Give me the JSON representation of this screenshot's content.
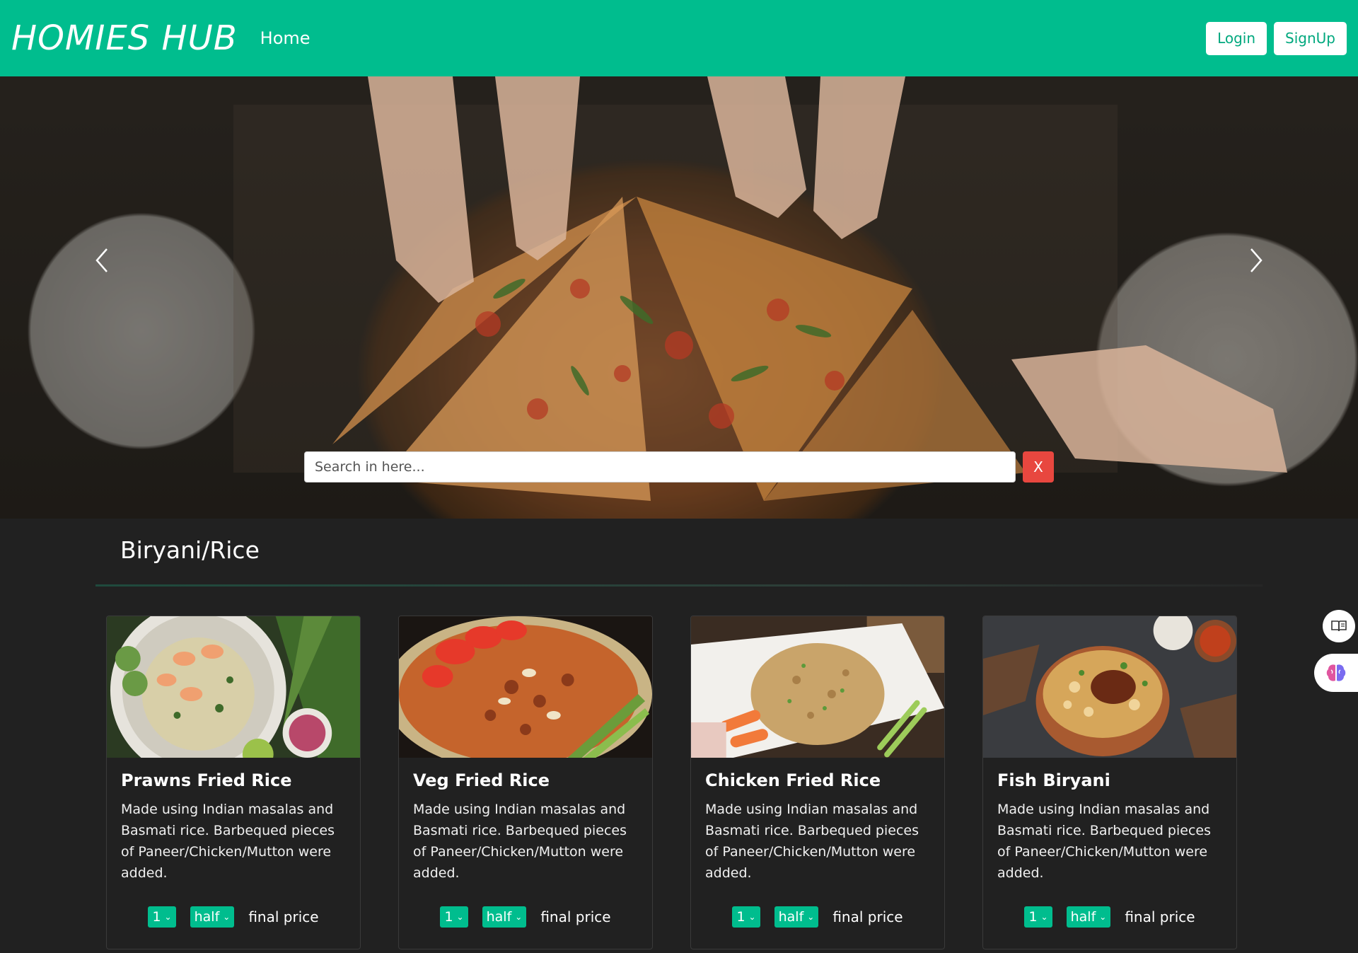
{
  "navbar": {
    "brand": "HOMIES HUB",
    "home_link": "Home",
    "login_label": "Login",
    "signup_label": "SignUp"
  },
  "hero": {
    "search_placeholder": "Search in here...",
    "clear_label": "X",
    "prev_icon": "chevron-left-icon",
    "next_icon": "chevron-right-icon"
  },
  "section": {
    "title": "Biryani/Rice"
  },
  "cards": [
    {
      "title": "Prawns Fried Rice",
      "description": "Made using Indian masalas and Basmati rice. Barbequed pieces of Paneer/Chicken/Mutton were added.",
      "qty": "1",
      "size": "half",
      "price_label": "final price"
    },
    {
      "title": "Veg Fried Rice",
      "description": "Made using Indian masalas and Basmati rice. Barbequed pieces of Paneer/Chicken/Mutton were added.",
      "qty": "1",
      "size": "half",
      "price_label": "final price"
    },
    {
      "title": "Chicken Fried Rice",
      "description": "Made using Indian masalas and Basmati rice. Barbequed pieces of Paneer/Chicken/Mutton were added.",
      "qty": "1",
      "size": "half",
      "price_label": "final price"
    },
    {
      "title": "Fish Biryani",
      "description": "Made using Indian masalas and Basmati rice. Barbequed pieces of Paneer/Chicken/Mutton were added.",
      "qty": "1",
      "size": "half",
      "price_label": "final price"
    }
  ],
  "colors": {
    "accent": "#00bd8e",
    "background": "#212121",
    "danger": "#e8473f"
  },
  "side_widgets": [
    "book-reader-icon",
    "brain-icon"
  ]
}
